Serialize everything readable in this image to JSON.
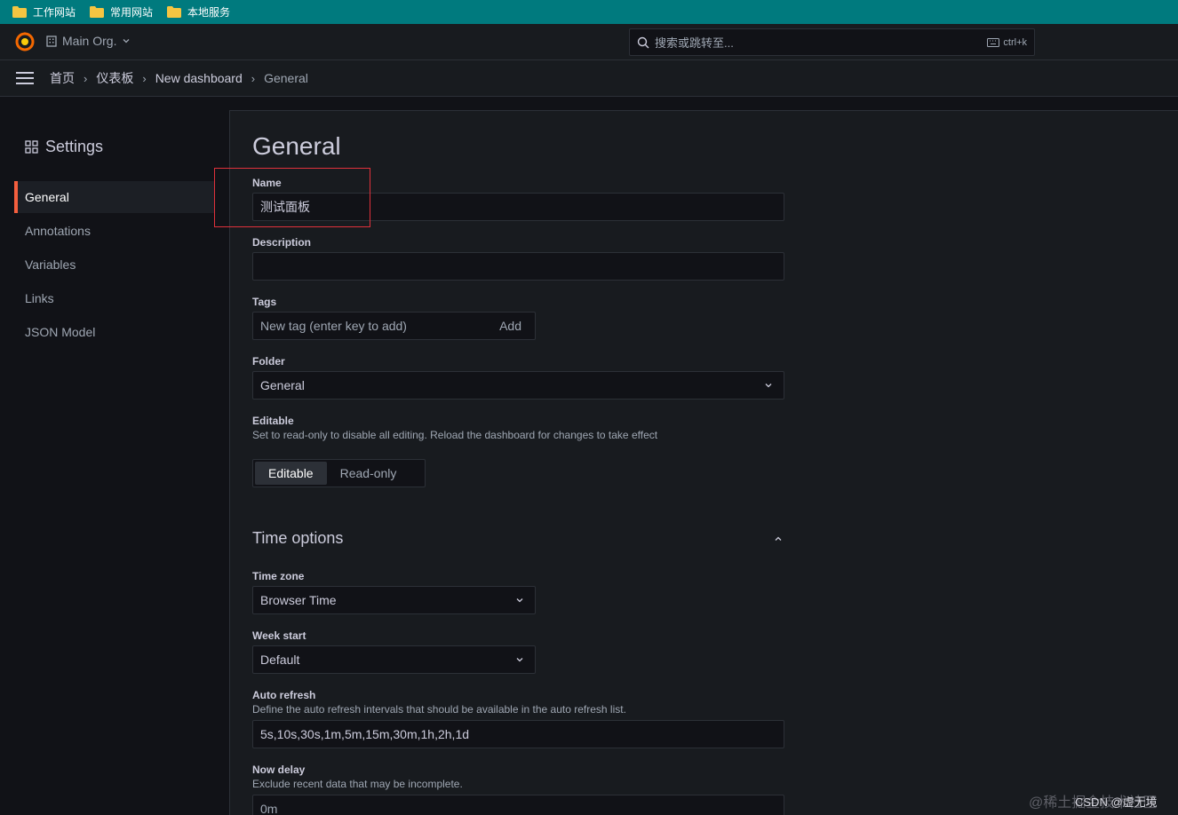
{
  "bookmarks": [
    {
      "label": "工作网站",
      "icon": "folder-icon"
    },
    {
      "label": "常用网站",
      "icon": "folder-icon"
    },
    {
      "label": "本地服务",
      "icon": "folder-icon"
    }
  ],
  "topnav": {
    "org_label": "Main Org.",
    "search_placeholder": "搜索或跳转至...",
    "search_shortcut": "ctrl+k"
  },
  "breadcrumb": [
    "首页",
    "仪表板",
    "New dashboard",
    "General"
  ],
  "sidebar": {
    "title": "Settings",
    "items": [
      {
        "label": "General",
        "active": true
      },
      {
        "label": "Annotations",
        "active": false
      },
      {
        "label": "Variables",
        "active": false
      },
      {
        "label": "Links",
        "active": false
      },
      {
        "label": "JSON Model",
        "active": false
      }
    ]
  },
  "general": {
    "title": "General",
    "name_label": "Name",
    "name_value": "测试面板",
    "description_label": "Description",
    "description_value": "",
    "tags_label": "Tags",
    "tags_placeholder": "New tag (enter key to add)",
    "tags_add": "Add",
    "folder_label": "Folder",
    "folder_value": "General",
    "editable_label": "Editable",
    "editable_desc": "Set to read-only to disable all editing. Reload the dashboard for changes to take effect",
    "editable_options": [
      "Editable",
      "Read-only"
    ],
    "editable_selected": "Editable"
  },
  "time_options": {
    "title": "Time options",
    "timezone_label": "Time zone",
    "timezone_value": "Browser Time",
    "week_start_label": "Week start",
    "week_start_value": "Default",
    "auto_refresh_label": "Auto refresh",
    "auto_refresh_desc": "Define the auto refresh intervals that should be available in the auto refresh list.",
    "auto_refresh_value": "5s,10s,30s,1m,5m,15m,30m,1h,2h,1d",
    "now_delay_label": "Now delay",
    "now_delay_desc": "Exclude recent data that may be incomplete.",
    "now_delay_placeholder": "0m"
  },
  "watermark": {
    "faint": "@稀土掘金技术社区",
    "overlay": "CSDN @虚无境"
  },
  "colors": {
    "accent": "#f55f3e",
    "highlight_box": "#e0313b",
    "bookmarks_bar": "#007a7e"
  }
}
